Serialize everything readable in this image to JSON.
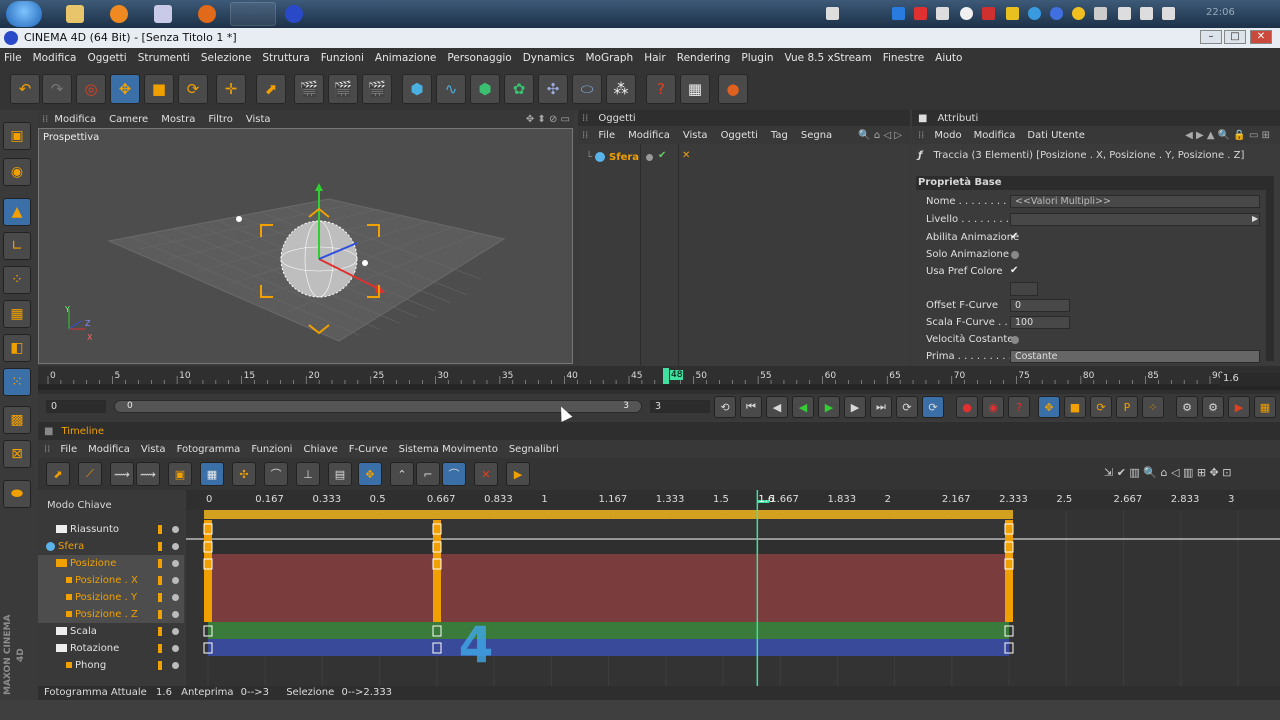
{
  "taskbar": {
    "clock": "22:06"
  },
  "window": {
    "title": "CINEMA 4D (64 Bit) - [Senza Titolo 1 *]"
  },
  "menubar": [
    "File",
    "Modifica",
    "Oggetti",
    "Strumenti",
    "Selezione",
    "Struttura",
    "Funzioni",
    "Animazione",
    "Personaggio",
    "Dynamics",
    "MoGraph",
    "Hair",
    "Rendering",
    "Plugin",
    "Vue 8.5 xStream",
    "Finestre",
    "Aiuto"
  ],
  "viewport": {
    "menu": [
      "Modifica",
      "Camere",
      "Mostra",
      "Filtro",
      "Vista"
    ],
    "label": "Prospettiva",
    "axis": {
      "x": "X",
      "y": "Y",
      "z": "Z"
    }
  },
  "objects": {
    "title": "Oggetti",
    "menu": [
      "File",
      "Modifica",
      "Vista",
      "Oggetti",
      "Tag",
      "Segna"
    ],
    "item": "Sfera"
  },
  "attributes": {
    "title": "Attributi",
    "menu": [
      "Modo",
      "Modifica",
      "Dati Utente"
    ],
    "track_title": "Traccia (3 Elementi) [Posizione . X, Posizione . Y, Posizione . Z]",
    "section": "Proprietà Base",
    "rows": {
      "nome": "Nome . . . . . . . . .",
      "nome_value": "<<Valori Multipli>>",
      "livello": "Livello . . . . . . . .",
      "abilita": "Abilita Animazione",
      "solo": "Solo Animazione",
      "usa_pref": "Usa Pref Colore",
      "offset": "Offset F-Curve",
      "offset_value": "0",
      "scala": "Scala F-Curve . . .",
      "scala_value": "100",
      "velocita": "Velocità Costante",
      "prima": "Prima . . . . . . . . .",
      "prima_value": "Costante"
    },
    "check": "✔"
  },
  "ruler": {
    "ticks": [
      "0",
      "5",
      "10",
      "15",
      "20",
      "25",
      "30",
      "35",
      "40",
      "45",
      "50",
      "55",
      "60",
      "65",
      "70",
      "75",
      "80",
      "85",
      "90"
    ],
    "current": "48",
    "right_value": "1.6"
  },
  "controls": {
    "start_frame": "0",
    "slider_left": "0",
    "slider_right": "3",
    "end_frame": "3"
  },
  "timeline": {
    "title": "Timeline",
    "menu": [
      "File",
      "Modifica",
      "Vista",
      "Fotogramma",
      "Funzioni",
      "Chiave",
      "F-Curve",
      "Sistema Movimento",
      "Segnalibri"
    ],
    "mode_label": "Modo Chiave",
    "ruler": [
      "0",
      "0.167",
      "0.333",
      "0.5",
      "0.667",
      "0.833",
      "1",
      "1.167",
      "1.333",
      "1.5",
      "1.667",
      "1.833",
      "2",
      "2.167",
      "2.333",
      "2.5",
      "2.667",
      "2.833",
      "3"
    ],
    "cursor_label": "1.6",
    "tree": [
      {
        "label": "Riassunto",
        "depth": 1,
        "folder": true
      },
      {
        "label": "Sfera",
        "depth": 0,
        "sphere": true
      },
      {
        "label": "Posizione",
        "depth": 1,
        "folder": true,
        "highlight": true
      },
      {
        "label": "Posizione . X",
        "depth": 2,
        "highlight": true
      },
      {
        "label": "Posizione . Y",
        "depth": 2,
        "highlight": true
      },
      {
        "label": "Posizione . Z",
        "depth": 2,
        "highlight": true
      },
      {
        "label": "Scala",
        "depth": 1,
        "folder": true
      },
      {
        "label": "Rotazione",
        "depth": 1,
        "folder": true
      },
      {
        "label": "Phong",
        "depth": 2
      }
    ],
    "keyframe_times": [
      0,
      0.667,
      2.333
    ],
    "cursor_time": 1.6
  },
  "status": {
    "current_label": "Fotogramma Attuale",
    "current_value": "1.6",
    "preview_label": "Anteprima",
    "preview_value": "0-->3",
    "selection_label": "Selezione",
    "selection_value": "0-->2.333"
  },
  "branding": {
    "maxon": "MAXON CINEMA 4D"
  },
  "colors": {
    "accent": "#f0a000",
    "selection": "#3a6fa8",
    "cursor": "#40e0a0"
  }
}
